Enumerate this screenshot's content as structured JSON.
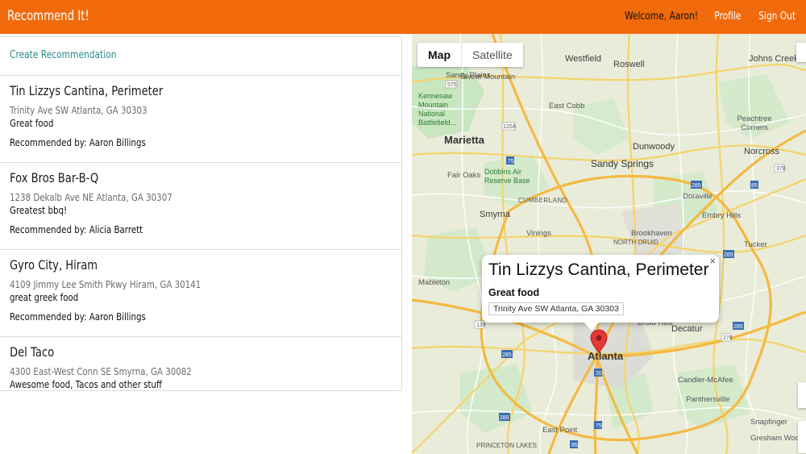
{
  "navbar": {
    "brand": "Recommend It!",
    "welcome": "Welcome, Aaron!",
    "profile": "Profile",
    "sign_out": "Sign Out",
    "color": "#f06a0c"
  },
  "panel": {
    "create_link": "Create Recommendation",
    "recommendations": [
      {
        "title": "Tin Lizzys Cantina, Perimeter",
        "address": "Trinity Ave SW Atlanta, GA 30303",
        "description": "Great food",
        "recommended_by": "Recommended by: Aaron Billings"
      },
      {
        "title": "Fox Bros Bar-B-Q",
        "address": "1238 Dekalb Ave NE Atlanta, GA 30307",
        "description": "Greatest bbq!",
        "recommended_by": "Recommended by: Alicia Barrett"
      },
      {
        "title": "Gyro City, Hiram",
        "address": "4109 Jimmy Lee Smith Pkwy Hiram, GA 30141",
        "description": "great greek food",
        "recommended_by": "Recommended by: Aaron Billings"
      },
      {
        "title": "Del Taco",
        "address": "4300 East-West Conn SE Smyrna, GA 30082",
        "description": "Awesome food, Tacos and other stuff"
      }
    ]
  },
  "map": {
    "type_map": "Map",
    "type_satellite": "Satellite",
    "info_window": {
      "title": "Tin Lizzys Cantina, Perimeter",
      "description": "Great food",
      "address": "Trinity Ave SW Atlanta, GA 30303",
      "close": "×"
    },
    "labels": {
      "westfield": "Westfield",
      "roswell": "Roswell",
      "johns_creek": "Johns Creek",
      "sweat": "Sweat Mountain",
      "sandy_plains": "Sandy Plains",
      "east_cobb": "East Cobb",
      "peachtree_corners": "Peachtree Corners",
      "kennesaw": "Kennesaw Mountain National Battlefield...",
      "marietta": "Marietta",
      "dunwoody": "Dunwoody",
      "norcross": "Norcross",
      "sandy_springs": "Sandy Springs",
      "fair_oaks": "Fair Oaks",
      "dobbins": "Dobbins Air Reserve Base",
      "cumberland": "CUMBERLAND",
      "doraville": "Doraville",
      "smyrna": "Smyrna",
      "embry_hills": "Embry Hills",
      "vinings": "Vinings",
      "north_druid": "NORTH DRUID",
      "brookhaven": "Brookhaven",
      "tucker": "Tucker",
      "mableton": "Mableton",
      "decatur": "Decatur",
      "druid_hills": "Druid Hills",
      "atlanta": "Atlanta",
      "candler": "Candler-McAfee",
      "panthersville": "Panthersville",
      "snapfinger": "Snapfinger",
      "east_point": "East Point",
      "princeton_lakes": "PRINCETON LAKES",
      "gresham": "Gresham Woods"
    }
  }
}
